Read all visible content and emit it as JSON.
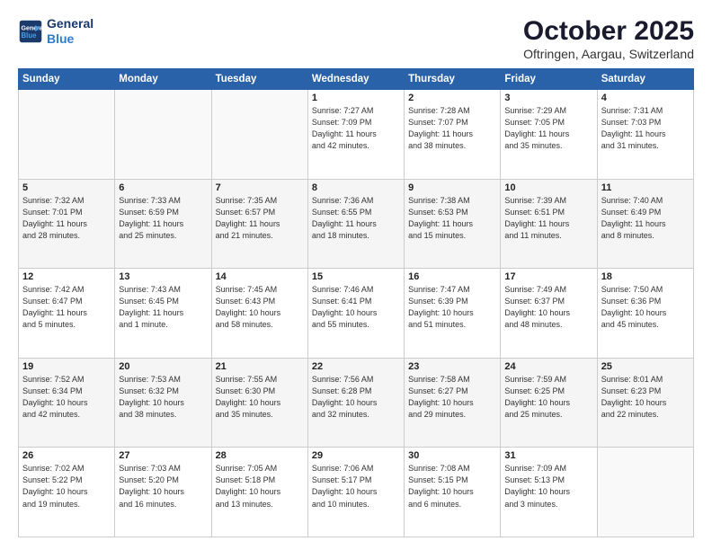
{
  "header": {
    "logo_line1": "General",
    "logo_line2": "Blue",
    "month": "October 2025",
    "location": "Oftringen, Aargau, Switzerland"
  },
  "days_of_week": [
    "Sunday",
    "Monday",
    "Tuesday",
    "Wednesday",
    "Thursday",
    "Friday",
    "Saturday"
  ],
  "weeks": [
    [
      {
        "num": "",
        "info": ""
      },
      {
        "num": "",
        "info": ""
      },
      {
        "num": "",
        "info": ""
      },
      {
        "num": "1",
        "info": "Sunrise: 7:27 AM\nSunset: 7:09 PM\nDaylight: 11 hours\nand 42 minutes."
      },
      {
        "num": "2",
        "info": "Sunrise: 7:28 AM\nSunset: 7:07 PM\nDaylight: 11 hours\nand 38 minutes."
      },
      {
        "num": "3",
        "info": "Sunrise: 7:29 AM\nSunset: 7:05 PM\nDaylight: 11 hours\nand 35 minutes."
      },
      {
        "num": "4",
        "info": "Sunrise: 7:31 AM\nSunset: 7:03 PM\nDaylight: 11 hours\nand 31 minutes."
      }
    ],
    [
      {
        "num": "5",
        "info": "Sunrise: 7:32 AM\nSunset: 7:01 PM\nDaylight: 11 hours\nand 28 minutes."
      },
      {
        "num": "6",
        "info": "Sunrise: 7:33 AM\nSunset: 6:59 PM\nDaylight: 11 hours\nand 25 minutes."
      },
      {
        "num": "7",
        "info": "Sunrise: 7:35 AM\nSunset: 6:57 PM\nDaylight: 11 hours\nand 21 minutes."
      },
      {
        "num": "8",
        "info": "Sunrise: 7:36 AM\nSunset: 6:55 PM\nDaylight: 11 hours\nand 18 minutes."
      },
      {
        "num": "9",
        "info": "Sunrise: 7:38 AM\nSunset: 6:53 PM\nDaylight: 11 hours\nand 15 minutes."
      },
      {
        "num": "10",
        "info": "Sunrise: 7:39 AM\nSunset: 6:51 PM\nDaylight: 11 hours\nand 11 minutes."
      },
      {
        "num": "11",
        "info": "Sunrise: 7:40 AM\nSunset: 6:49 PM\nDaylight: 11 hours\nand 8 minutes."
      }
    ],
    [
      {
        "num": "12",
        "info": "Sunrise: 7:42 AM\nSunset: 6:47 PM\nDaylight: 11 hours\nand 5 minutes."
      },
      {
        "num": "13",
        "info": "Sunrise: 7:43 AM\nSunset: 6:45 PM\nDaylight: 11 hours\nand 1 minute."
      },
      {
        "num": "14",
        "info": "Sunrise: 7:45 AM\nSunset: 6:43 PM\nDaylight: 10 hours\nand 58 minutes."
      },
      {
        "num": "15",
        "info": "Sunrise: 7:46 AM\nSunset: 6:41 PM\nDaylight: 10 hours\nand 55 minutes."
      },
      {
        "num": "16",
        "info": "Sunrise: 7:47 AM\nSunset: 6:39 PM\nDaylight: 10 hours\nand 51 minutes."
      },
      {
        "num": "17",
        "info": "Sunrise: 7:49 AM\nSunset: 6:37 PM\nDaylight: 10 hours\nand 48 minutes."
      },
      {
        "num": "18",
        "info": "Sunrise: 7:50 AM\nSunset: 6:36 PM\nDaylight: 10 hours\nand 45 minutes."
      }
    ],
    [
      {
        "num": "19",
        "info": "Sunrise: 7:52 AM\nSunset: 6:34 PM\nDaylight: 10 hours\nand 42 minutes."
      },
      {
        "num": "20",
        "info": "Sunrise: 7:53 AM\nSunset: 6:32 PM\nDaylight: 10 hours\nand 38 minutes."
      },
      {
        "num": "21",
        "info": "Sunrise: 7:55 AM\nSunset: 6:30 PM\nDaylight: 10 hours\nand 35 minutes."
      },
      {
        "num": "22",
        "info": "Sunrise: 7:56 AM\nSunset: 6:28 PM\nDaylight: 10 hours\nand 32 minutes."
      },
      {
        "num": "23",
        "info": "Sunrise: 7:58 AM\nSunset: 6:27 PM\nDaylight: 10 hours\nand 29 minutes."
      },
      {
        "num": "24",
        "info": "Sunrise: 7:59 AM\nSunset: 6:25 PM\nDaylight: 10 hours\nand 25 minutes."
      },
      {
        "num": "25",
        "info": "Sunrise: 8:01 AM\nSunset: 6:23 PM\nDaylight: 10 hours\nand 22 minutes."
      }
    ],
    [
      {
        "num": "26",
        "info": "Sunrise: 7:02 AM\nSunset: 5:22 PM\nDaylight: 10 hours\nand 19 minutes."
      },
      {
        "num": "27",
        "info": "Sunrise: 7:03 AM\nSunset: 5:20 PM\nDaylight: 10 hours\nand 16 minutes."
      },
      {
        "num": "28",
        "info": "Sunrise: 7:05 AM\nSunset: 5:18 PM\nDaylight: 10 hours\nand 13 minutes."
      },
      {
        "num": "29",
        "info": "Sunrise: 7:06 AM\nSunset: 5:17 PM\nDaylight: 10 hours\nand 10 minutes."
      },
      {
        "num": "30",
        "info": "Sunrise: 7:08 AM\nSunset: 5:15 PM\nDaylight: 10 hours\nand 6 minutes."
      },
      {
        "num": "31",
        "info": "Sunrise: 7:09 AM\nSunset: 5:13 PM\nDaylight: 10 hours\nand 3 minutes."
      },
      {
        "num": "",
        "info": ""
      }
    ]
  ]
}
